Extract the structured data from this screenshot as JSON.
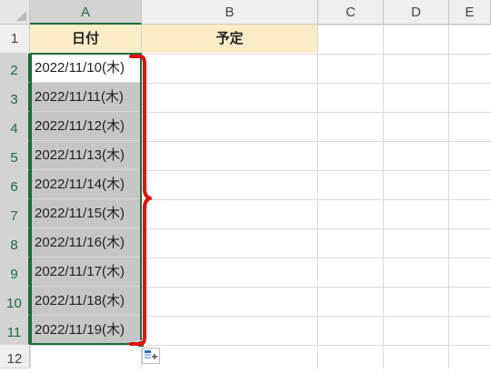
{
  "columns": [
    "A",
    "B",
    "C",
    "D",
    "E"
  ],
  "rows": [
    "1",
    "2",
    "3",
    "4",
    "5",
    "6",
    "7",
    "8",
    "9",
    "10",
    "11",
    "12"
  ],
  "header_cells": {
    "a1": "日付",
    "b1": "予定"
  },
  "dates": [
    "2022/11/10(木)",
    "2022/11/11(木)",
    "2022/11/12(木)",
    "2022/11/13(木)",
    "2022/11/14(木)",
    "2022/11/15(木)",
    "2022/11/16(木)",
    "2022/11/17(木)",
    "2022/11/18(木)",
    "2022/11/19(木)"
  ],
  "icons": {
    "quick_analysis": "quick-analysis-icon",
    "brace": "red-brace-annotation"
  },
  "colors": {
    "selection": "#1e6b3c",
    "header_fill": "#fdecc8",
    "selected_fill": "#c6c6c6",
    "annotation": "#e01010"
  }
}
